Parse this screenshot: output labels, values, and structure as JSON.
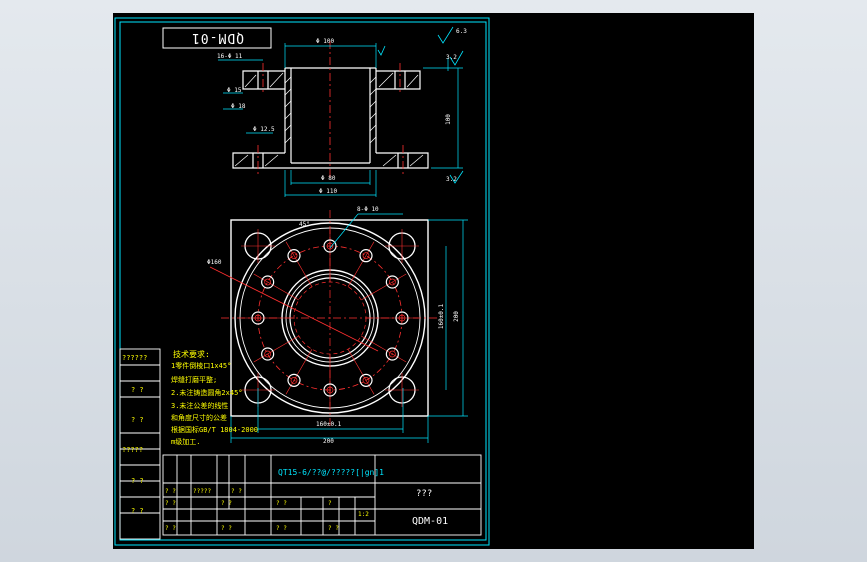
{
  "app": {
    "title_block_drawing_no": "QDM-01",
    "title_block_name": "???",
    "title_block_material": "QT15-6/??@/?????[|gn]1",
    "mirrored_title": "QDM-01"
  },
  "technical_notes": {
    "heading": "技术要求:",
    "lines": [
      "1零件倒棱口1x45°",
      "焊缝打磨平整;",
      "2.未注铸造圆角2x45°",
      "3.未注公差的线性",
      "和角度尺寸的公差",
      "根据国标GB/T 1804-2000",
      "m级加工."
    ]
  },
  "side_table": {
    "cells": [
      "??????",
      "? ?",
      "? ?",
      "?????",
      "? ?",
      "? ?"
    ]
  },
  "title_block_small": {
    "row1": [
      "? ?",
      "?????",
      "? ?"
    ],
    "row2": [
      "? ?",
      "? ?",
      "? ?",
      "?",
      "1:2"
    ],
    "row3": [
      "? ?",
      "? ?",
      "? ?",
      "? ?"
    ]
  },
  "dimensions": {
    "top_width": "Φ 100",
    "tab_width": "16-Φ 11",
    "small1": "Φ 15",
    "small2": "Φ 18",
    "hole_note": "Φ 12.5",
    "inner_dia": "Φ 80",
    "outer_dia": "Φ 110",
    "height": "100",
    "right_small": "3.2",
    "ra1": "6.3",
    "ra2": "3.2",
    "plan_holes": "8-Φ 10",
    "plan_circle": "Φ160",
    "plan_right_inner": "160±0.1",
    "plan_right_outer": "200",
    "plan_bottom_inner": "160±0.1",
    "plan_bottom_outer": "200",
    "angle": "45°"
  }
}
